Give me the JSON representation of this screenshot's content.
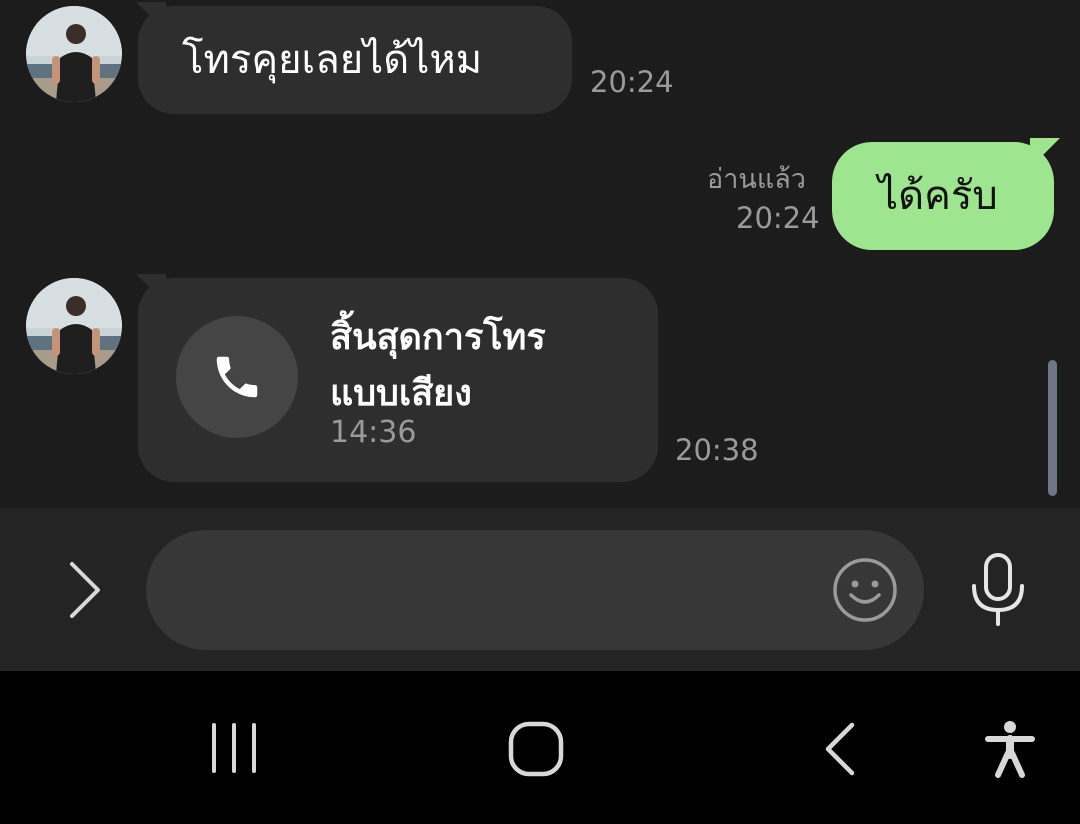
{
  "messages": {
    "m1": {
      "text": "โทรคุยเลยได้ไหม",
      "time": "20:24"
    },
    "m2": {
      "text": "ได้ครับ",
      "read_label": "อ่านแล้ว",
      "time": "20:24"
    },
    "m3": {
      "title_line1": "สิ้นสุดการโทร",
      "title_line2": "แบบเสียง",
      "duration": "14:36",
      "time": "20:38"
    }
  },
  "input": {
    "placeholder": ""
  },
  "colors": {
    "background": "#1c1c1c",
    "incoming_bubble": "#2e2e2e",
    "outgoing_bubble": "#9de58f",
    "timestamp": "#9a9a9a",
    "input_bar": "#242424",
    "input_field": "#373737",
    "nav_bar": "#000000"
  },
  "icons": {
    "expand": "chevron-right-icon",
    "call": "phone-icon",
    "emoji": "smiley-icon",
    "mic": "microphone-icon",
    "nav_recents": "recent-apps-icon",
    "nav_home": "home-icon",
    "nav_back": "back-icon",
    "nav_accessibility": "accessibility-icon"
  }
}
